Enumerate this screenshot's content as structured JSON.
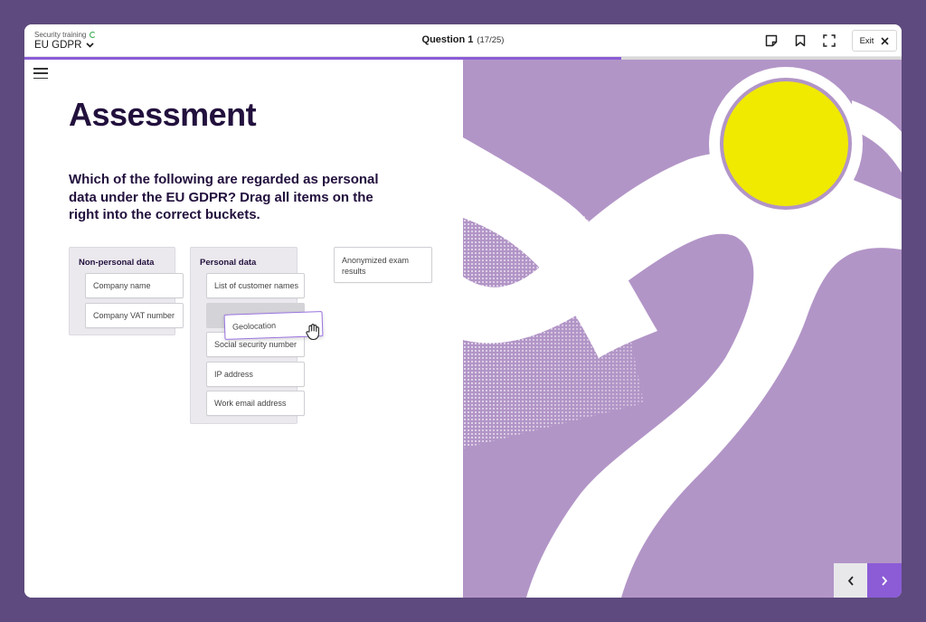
{
  "header": {
    "kicker": "Security training",
    "course_title": "EU GDPR",
    "question_label": "Question 1",
    "question_count": "(17/25)",
    "exit_label": "Exit",
    "progress": 0.68
  },
  "main": {
    "heading": "Assessment",
    "prompt": "Which of the following are regarded as personal data under the EU GDPR? Drag all items on the right into the correct buckets."
  },
  "buckets": {
    "non_personal": {
      "title": "Non-personal data",
      "items": [
        "Company name",
        "Company VAT number"
      ]
    },
    "personal": {
      "title": "Personal data",
      "items": [
        "List of customer names",
        "Social security number",
        "IP address",
        "Work email address"
      ]
    }
  },
  "dragging_item": "Geolocation",
  "unsorted_items": [
    "Anonymized exam results"
  ],
  "colors": {
    "accent": "#8b5cd6",
    "illustration_bg": "#b295c7",
    "sun": "#f0e900",
    "heading": "#22103d"
  },
  "icons": [
    "spinner-icon",
    "chevron-down-icon",
    "note-icon",
    "bookmark-icon",
    "fullscreen-icon",
    "close-icon",
    "menu-icon",
    "grab-hand-icon",
    "chevron-left-icon",
    "chevron-right-icon"
  ]
}
